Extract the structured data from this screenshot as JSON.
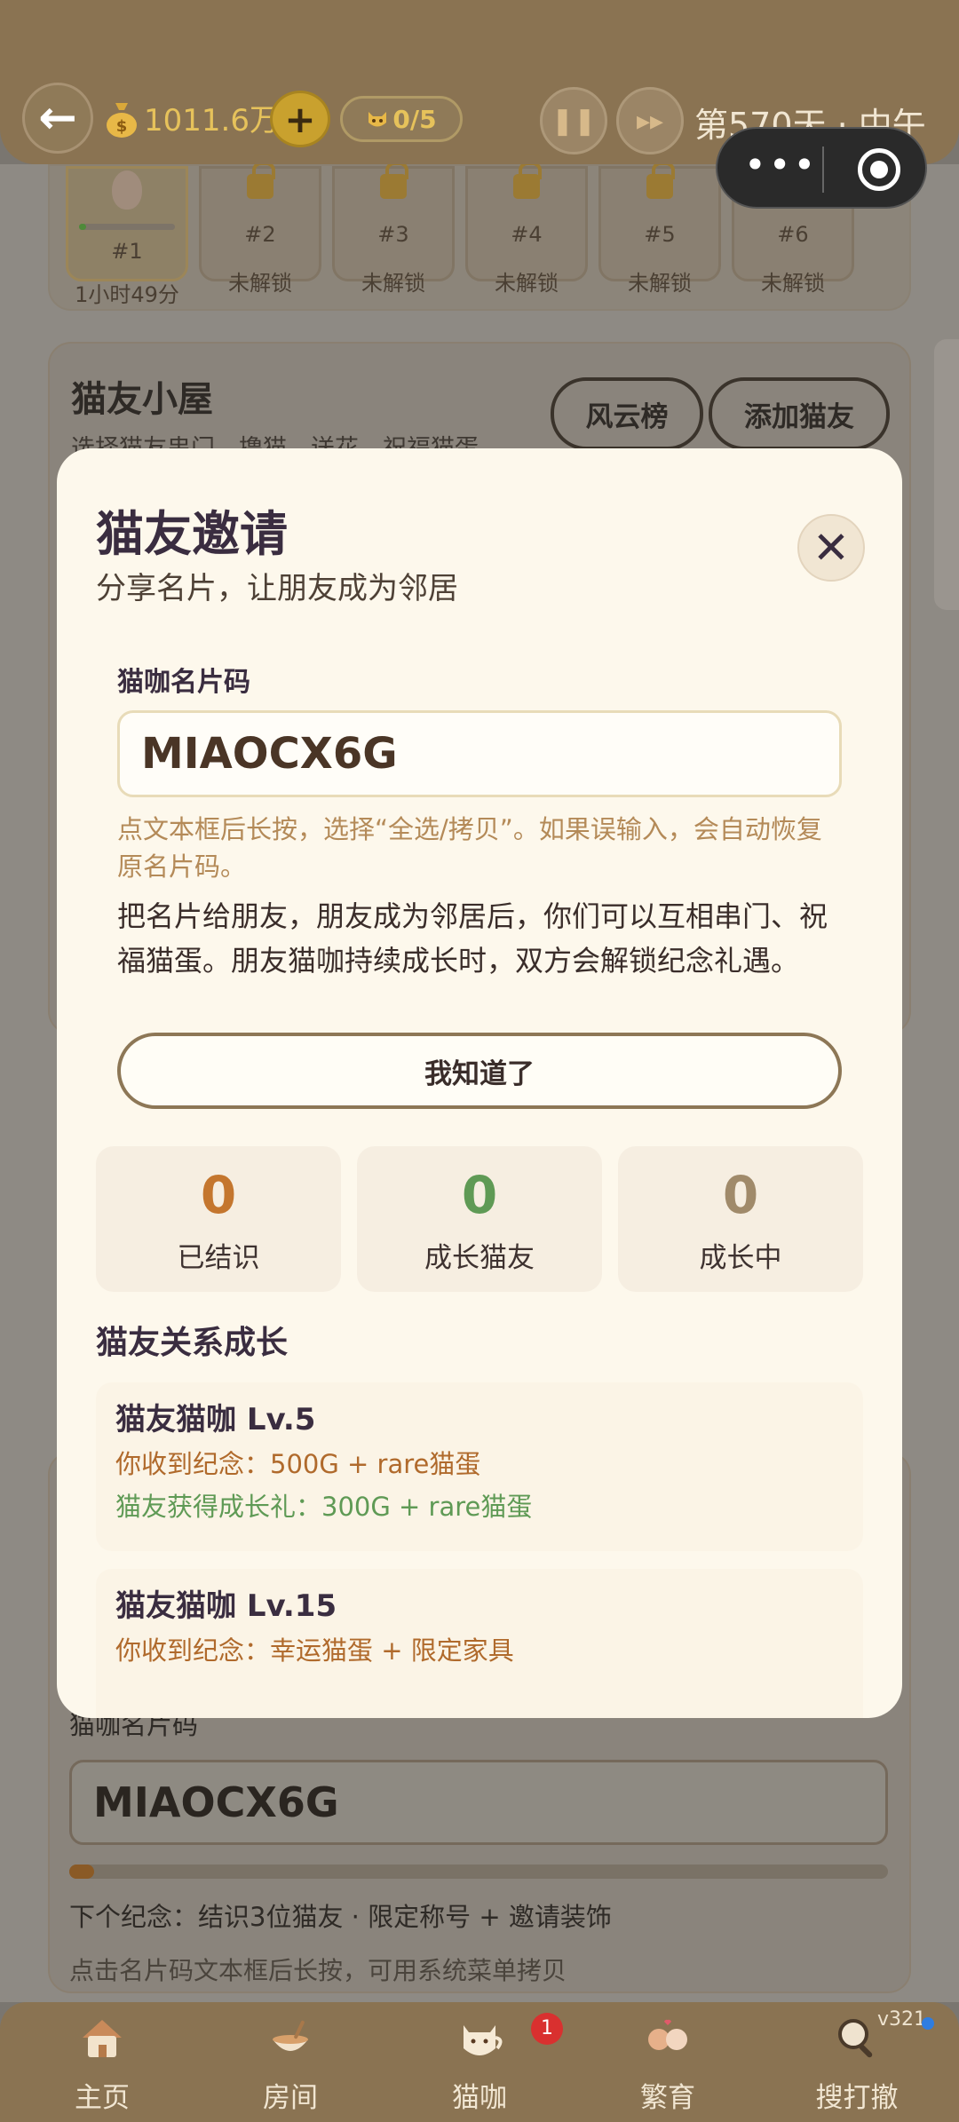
{
  "topbar": {
    "coins": "1011.6万",
    "plus_label": "+",
    "cat_count": "0/5",
    "day": "第570天 · 中午"
  },
  "slots": [
    {
      "num": "#1",
      "status": "1小时49分",
      "unlocked": true,
      "progress": 0.05
    },
    {
      "num": "#2",
      "status": "未解锁"
    },
    {
      "num": "#3",
      "status": "未解锁"
    },
    {
      "num": "#4",
      "status": "未解锁"
    },
    {
      "num": "#5",
      "status": "未解锁"
    },
    {
      "num": "#6",
      "status": "未解锁"
    }
  ],
  "friends_house": {
    "title": "猫友小屋",
    "subtitle": "选择猫友串门、撸猫、送花、祝福猫蛋",
    "ranking_button": "风云榜",
    "add_friend_button": "添加猫友"
  },
  "card_panel": {
    "code_label": "猫咖名片码",
    "code": "MIAOCX6G",
    "progress": 0.03,
    "next_reward": "下个纪念：结识3位猫友 · 限定称号 + 邀请装饰",
    "hint": "点击名片码文本框后长按，可用系统菜单拷贝"
  },
  "modal": {
    "title": "猫友邀请",
    "subtitle": "分享名片，让朋友成为邻居",
    "code_label": "猫咖名片码",
    "code": "MIAOCX6G",
    "hint": "点文本框后长按，选择“全选/拷贝”。如果误输入，会自动恢复原名片码。",
    "description": "把名片给朋友，朋友成为邻居后，你们可以互相串门、祝福猫蛋。朋友猫咖持续成长时，双方会解锁纪念礼遇。",
    "ok_button": "我知道了",
    "stats": [
      {
        "value": "0",
        "label": "已结识",
        "color": "#c4762e"
      },
      {
        "value": "0",
        "label": "成长猫友",
        "color": "#5f9a55"
      },
      {
        "value": "0",
        "label": "成长中",
        "color": "#a08a6a"
      }
    ],
    "growth_title": "猫友关系成长",
    "growth": [
      {
        "name": "猫友猫咖 Lv.5",
        "reward_you": "你收到纪念：500G + rare猫蛋",
        "reward_friend": "猫友获得成长礼：300G + rare猫蛋"
      },
      {
        "name": "猫友猫咖 Lv.15",
        "reward_you": "你收到纪念：幸运猫蛋 + 限定家具"
      }
    ]
  },
  "nav": {
    "items": [
      {
        "label": "主页",
        "icon": "house-icon"
      },
      {
        "label": "房间",
        "icon": "bowl-icon"
      },
      {
        "label": "猫咖",
        "icon": "cat-cup-icon"
      },
      {
        "label": "繁育",
        "icon": "cat-pair-icon"
      },
      {
        "label": "搜打撤",
        "icon": "magnifier-icon"
      }
    ],
    "badge": "1",
    "version": "v321"
  }
}
